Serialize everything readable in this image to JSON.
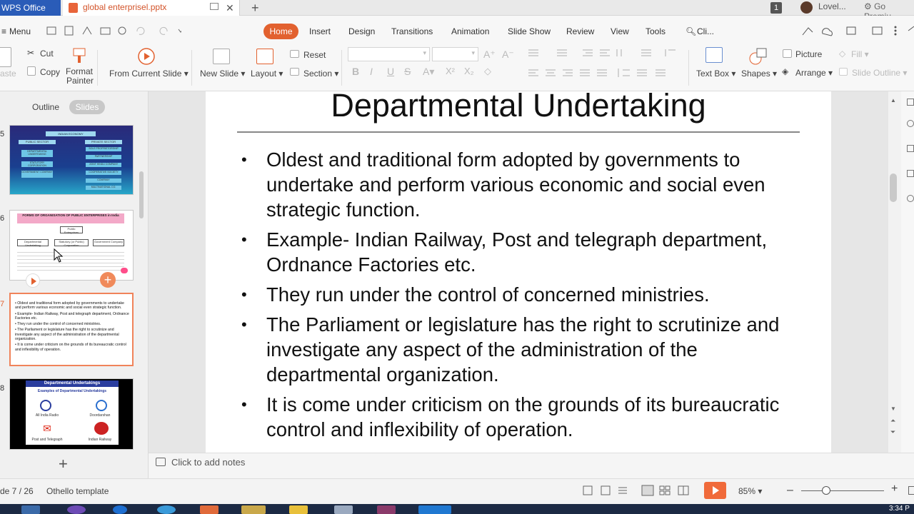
{
  "titlebar": {
    "app_name": "WPS Office",
    "doc_name": "global enterprisel.pptx",
    "badge_count": "1",
    "user_name": "Lovel...",
    "premium_label": "Go Premiu"
  },
  "ribbon_tabs": {
    "menu": "Menu",
    "home": "Home",
    "insert": "Insert",
    "design": "Design",
    "transitions": "Transitions",
    "animation": "Animation",
    "slide_show": "Slide Show",
    "review": "Review",
    "view": "View",
    "tools": "Tools",
    "search": "Cli..."
  },
  "ribbon": {
    "paste": "aste",
    "cut": "Cut",
    "copy": "Copy",
    "format_painter_1": "Format",
    "format_painter_2": "Painter",
    "from_current_slide": "From Current Slide",
    "new_slide": "New Slide",
    "layout": "Layout",
    "reset": "Reset",
    "section": "Section",
    "text_box": "Text Box",
    "shapes": "Shapes",
    "picture": "Picture",
    "arrange": "Arrange",
    "fill": "Fill",
    "slide_outline": "Slide Outline"
  },
  "left_panel": {
    "outline_tab": "Outline",
    "slides_tab": "Slides",
    "slide_numbers": [
      "5",
      "6",
      "7",
      "8"
    ],
    "thumb5": {
      "top": "INDIAN ECONOMY",
      "public": "PUBLIC SECTOR",
      "private": "PRIVATE SECTOR",
      "left_items": [
        "DEPARTMENTAL UNDERTAKING",
        "STATUTORY CORPORATION",
        "GOVERNMENT COMPANY"
      ],
      "right_items": [
        "SOLE PROPRIETORSHIP",
        "PARTNERSHIP",
        "JOINT HINDU COMPANY",
        "COOPERATIVE SOCIETY",
        "COMPANY",
        "MULTINATIONAL CO."
      ]
    },
    "thumb6": {
      "title": "FORMS OF ORGANISATION OF PUBLIC ENTERPRISES in India",
      "root": "Public Enterprises",
      "boxes": [
        "Departmental Undertaking",
        "Statutory (or Public) Corporation",
        "Government Company"
      ]
    },
    "thumb7": {
      "bullets": [
        "Oldest and traditional form adopted by governments to undertake and perform various economic and social even strategic function.",
        "Example- Indian Railway, Post and telegraph department, Ordnance Factories etc.",
        "They run under the control of concerned ministries.",
        "The Parliament or legislature has the right to scrutinize and investigate any aspect of the administration of the departmental organization.",
        "It is come under criticism on the grounds of its bureaucratic control and inflexibility of operation."
      ]
    },
    "thumb8": {
      "title": "Departmental Undertakings",
      "subtitle": "Examples of Departmental Undertakings",
      "items": [
        "All India Radio",
        "Doordarshan",
        "Post and Telegraph",
        "Indian Railway"
      ]
    }
  },
  "slide": {
    "title": "Departmental Undertaking",
    "bullets": [
      "Oldest and traditional form adopted by governments to undertake and perform various economic and social even strategic function.",
      "Example- Indian Railway, Post and telegraph department, Ordnance Factories etc.",
      "They run under the control of concerned ministries.",
      "The Parliament or legislature has the right to scrutinize and investigate any aspect of the administration of the departmental organization.",
      "It is come under criticism on the grounds of its bureaucratic control and inflexibility of operation."
    ]
  },
  "notes": {
    "placeholder": "Click to add notes"
  },
  "statusbar": {
    "slide_counter": "de 7 / 26",
    "template": "Othello template",
    "zoom": "85%"
  },
  "taskbar": {
    "time": "3:34 P"
  },
  "colors": {
    "accent": "#e2612f",
    "brand": "#2a5cb8"
  }
}
